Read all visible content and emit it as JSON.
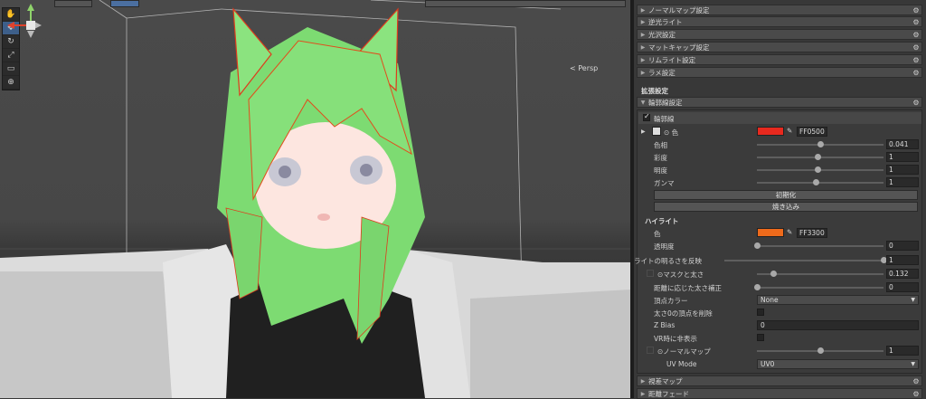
{
  "scene": {
    "persp_label": "Persp",
    "gizmo": {
      "y_axis": "y",
      "x_axis": "x"
    },
    "tools": [
      "hand-tool",
      "move-tool",
      "rotate-tool",
      "scale-tool",
      "rect-tool",
      "transform-tool"
    ]
  },
  "inspector": {
    "collapsed_sections": [
      "ノーマルマップ設定",
      "逆光ライト",
      "光沢設定",
      "マットキャップ設定",
      "リムライト設定",
      "ラメ設定"
    ],
    "extended_settings_label": "拡張設定",
    "outline_settings_label": "輪郭線設定",
    "outline_toggle_label": "輪郭線",
    "outline": {
      "color_label": "色",
      "color_hex": "FF0500",
      "color_value": "#e8291e",
      "hue_label": "色相",
      "hue_value": "0.041",
      "hue_pos": 0.5,
      "saturation_label": "彩度",
      "saturation_value": "1",
      "saturation_pos": 0.48,
      "brightness_label": "明度",
      "brightness_value": "1",
      "brightness_pos": 0.48,
      "gamma_label": "ガンマ",
      "gamma_value": "1",
      "gamma_pos": 0.47,
      "reset_button": "初期化",
      "bake_button": "焼き込み"
    },
    "highlight": {
      "title": "ハイライト",
      "color_label": "色",
      "color_hex": "FF3300",
      "color_value": "#ee6a1b",
      "transparency_label": "透明度",
      "transparency_value": "0",
      "transparency_pos": 0.0
    },
    "light_invert_label": "ライトの明るさを反映",
    "light_invert_value": "1",
    "light_invert_pos": 1.0,
    "mask_width_label": "マスクと太さ",
    "mask_width_value": "0.132",
    "mask_width_pos": 0.13,
    "distance_width_label": "距離に応じた太さ補正",
    "distance_width_value": "0",
    "distance_width_pos": 0.0,
    "vertex_color_label": "頂点カラー",
    "vertex_color_value": "None",
    "delete_zero_label": "太さ0の頂点を削除",
    "zbias_label": "Z Bias",
    "zbias_value": "0",
    "vr_hide_label": "VR時に非表示",
    "normal_map_label": "ノーマルマップ",
    "normal_map_value": "1",
    "normal_map_pos": 0.5,
    "uv_mode_label": "UV Mode",
    "uv_mode_value": "UV0",
    "bottom_sections": [
      "視差マップ",
      "距離フェード"
    ]
  }
}
